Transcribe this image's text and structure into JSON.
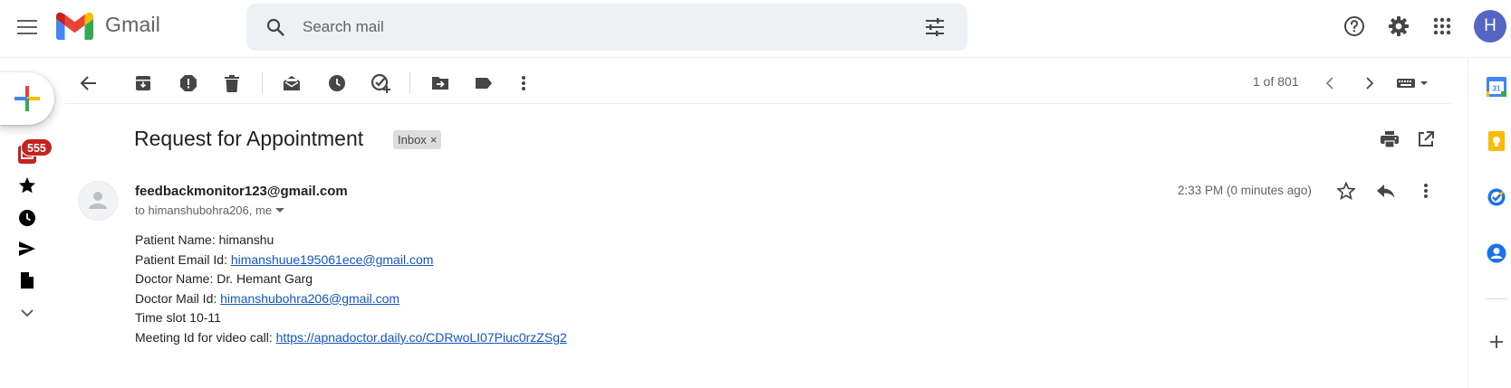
{
  "app": {
    "name": "Gmail"
  },
  "colors": {
    "accent_blue": "#1155cc",
    "badge_red": "#c5221f",
    "avatar_bg": "#5565c4",
    "search_bg": "#eef1f4"
  },
  "header": {
    "search": {
      "placeholder": "Search mail",
      "value": ""
    },
    "avatar_initial": "H",
    "icons": [
      "menu-icon",
      "gmail-logo",
      "search-icon",
      "search-options-icon",
      "help-icon",
      "settings-icon",
      "apps-icon"
    ]
  },
  "left_rail": {
    "compose_icon": "plus-icon",
    "unread_badge": "555",
    "items": [
      "mail-icon",
      "star-icon",
      "clock-icon",
      "send-icon",
      "draft-icon",
      "chevron-down-icon"
    ]
  },
  "toolbar": {
    "pager": "1 of 801",
    "icons": [
      "back-arrow-icon",
      "archive-icon",
      "report-spam-icon",
      "delete-icon",
      "mark-unread-icon",
      "snooze-icon",
      "add-task-icon",
      "move-to-icon",
      "label-icon",
      "more-vert-icon",
      "prev-icon",
      "next-icon",
      "keyboard-icon"
    ]
  },
  "email": {
    "subject": "Request for Appointment",
    "label_chip": "Inbox",
    "label_close": "×",
    "sender": "feedbackmonitor123@gmail.com",
    "recipients": "to himanshubohra206, me",
    "timestamp": "2:33 PM (0 minutes ago)",
    "body": {
      "patient_name_label": "Patient Name: ",
      "patient_name": "himanshu",
      "patient_email_label": "Patient Email Id: ",
      "patient_email": "himanshuue195061ece@gmail.com",
      "doctor_name_label": "Doctor Name: ",
      "doctor_name": "Dr. Hemant Garg",
      "doctor_mail_label": "Doctor Mail Id: ",
      "doctor_mail": "himanshubohra206@gmail.com",
      "time_slot_label": "Time slot ",
      "time_slot": "10-11",
      "meeting_label": "Meeting Id for video call: ",
      "meeting_link": "https://apnadoctor.daily.co/CDRwoLI07Piuc0rzZSg2"
    }
  },
  "side_panel": {
    "calendar_day": "31",
    "items": [
      "calendar-icon",
      "keep-icon",
      "tasks-icon",
      "contacts-icon",
      "add-icon"
    ]
  }
}
